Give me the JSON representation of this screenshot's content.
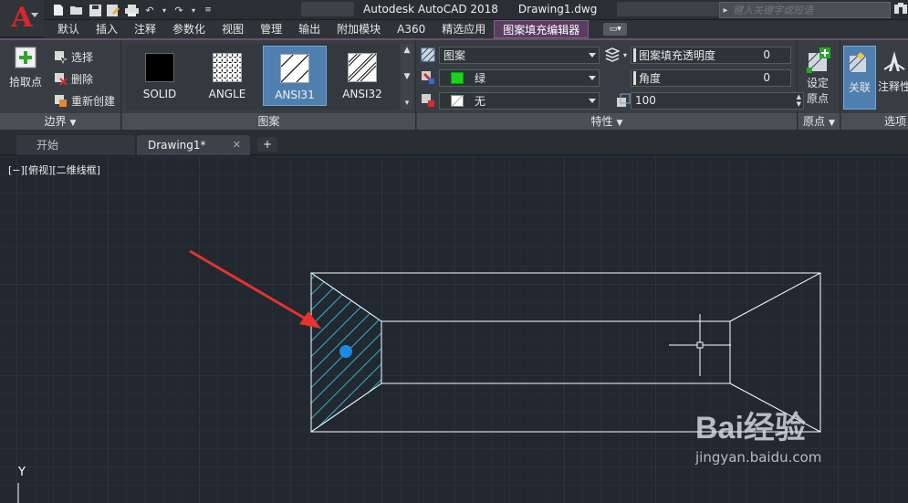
{
  "window": {
    "app_name": "Autodesk AutoCAD 2018",
    "doc_name": "Drawing1.dwg"
  },
  "search": {
    "placeholder": "键入关键字或短语"
  },
  "ribbon_tabs": [
    {
      "label": "默认",
      "active": false
    },
    {
      "label": "插入",
      "active": false
    },
    {
      "label": "注释",
      "active": false
    },
    {
      "label": "参数化",
      "active": false
    },
    {
      "label": "视图",
      "active": false
    },
    {
      "label": "管理",
      "active": false
    },
    {
      "label": "输出",
      "active": false
    },
    {
      "label": "附加模块",
      "active": false
    },
    {
      "label": "A360",
      "active": false
    },
    {
      "label": "精选应用",
      "active": false
    },
    {
      "label": "图案填充编辑器",
      "active": true
    }
  ],
  "boundary_panel": {
    "pick_point": "拾取点",
    "select": "选择",
    "remove": "删除",
    "recreate": "重新创建",
    "title": "边界"
  },
  "pattern_panel": {
    "title": "图案",
    "patterns": [
      {
        "label": "SOLID",
        "active": false
      },
      {
        "label": "ANGLE",
        "active": false
      },
      {
        "label": "ANSI31",
        "active": true
      },
      {
        "label": "ANSI32",
        "active": false
      }
    ]
  },
  "properties_panel": {
    "title": "特性",
    "hatch_type": "图案",
    "color": "绿",
    "color_hex": "#1fd11f",
    "background": "无",
    "transparency_label": "图案填充透明度",
    "transparency_value": "0",
    "angle_label": "角度",
    "angle_value": "0",
    "scale_value": "100"
  },
  "origin_panel": {
    "set_origin_line1": "设定",
    "set_origin_line2": "原点",
    "title": "原点"
  },
  "options_panel": {
    "associative": "关联",
    "annotative": "注释性",
    "title": "选项"
  },
  "doc_tabs": [
    {
      "label": "开始",
      "active": false
    },
    {
      "label": "Drawing1*",
      "active": true
    }
  ],
  "viewport": {
    "label": "[−][俯视][二维线框]",
    "ucs_y": "Y"
  },
  "watermark": {
    "brand": "Bai经验",
    "url": "jingyan.baidu.com"
  },
  "colors": {
    "hatch": "#2fb3c9",
    "arrow": "#e8322d",
    "grip": "#1e88e5",
    "lines": "#ffffff"
  }
}
